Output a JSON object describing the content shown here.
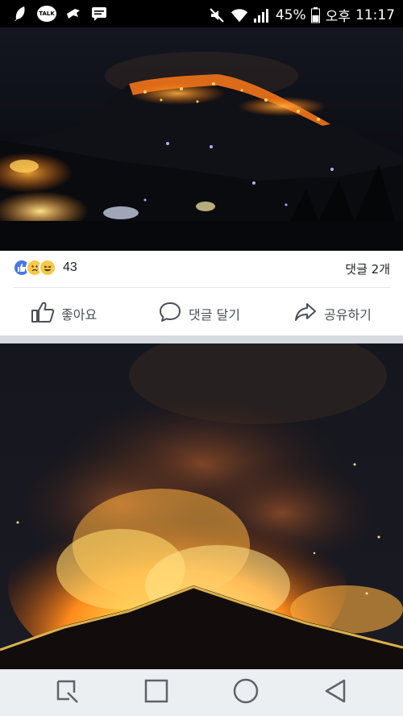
{
  "status_bar": {
    "talk_label": "TALK",
    "battery": "45%",
    "ampm": "오후",
    "time": "11:17",
    "icons": [
      "feather-icon",
      "kakaotalk-icon",
      "bird-icon",
      "message-icon",
      "mute-icon",
      "wifi-icon",
      "signal-icon",
      "battery-icon"
    ]
  },
  "post": {
    "reactions": [
      "like",
      "sad",
      "haha"
    ],
    "reaction_count": "43",
    "comment_count": "댓글 2개",
    "actions": {
      "like": "좋아요",
      "comment": "댓글 달기",
      "share": "공유하기"
    }
  },
  "nav_bar": {
    "buttons": [
      "recent-apps",
      "home",
      "circle",
      "back"
    ]
  },
  "colors": {
    "accent_blue": "#4a76e8",
    "fire_orange": "#ff8a1c",
    "fire_yellow": "#ffd24a",
    "night_sky": "#0b0d14"
  }
}
